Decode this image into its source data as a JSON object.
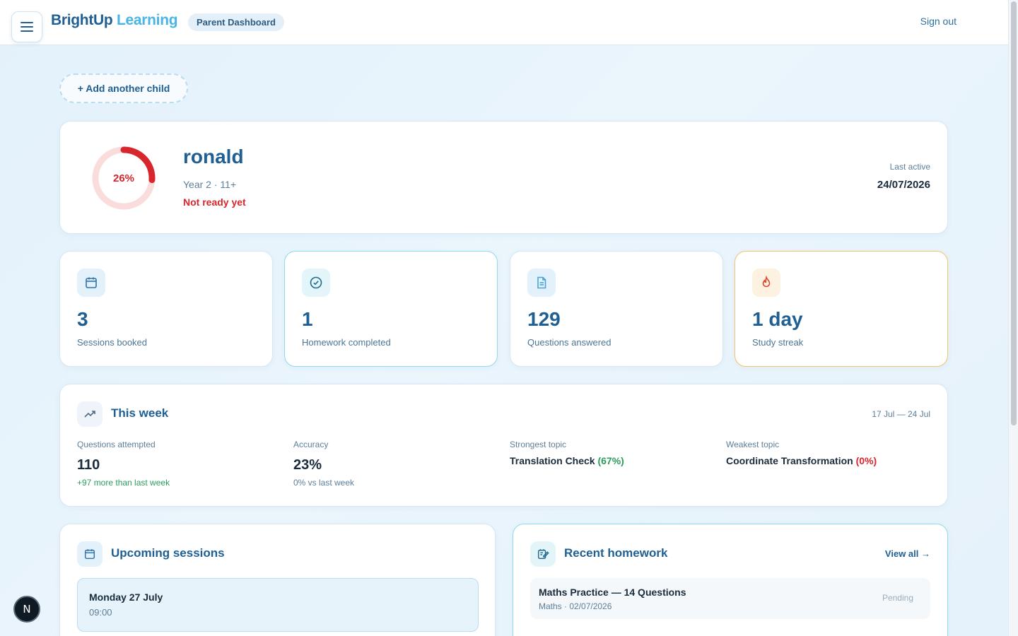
{
  "header": {
    "brand_part1": "BrightUp",
    "brand_part2": "Learning",
    "role_badge": "Parent Dashboard",
    "signout": "Sign out",
    "menu_icon": "hamburger-menu-icon"
  },
  "actions": {
    "add_child": "+ Add another child"
  },
  "profile": {
    "readiness_percent": "26%",
    "readiness_value": 0.26,
    "name": "ronald",
    "meta": "Year 2 · 11+",
    "status": "Not ready yet",
    "last_active_label": "Last active",
    "last_active_date": "24/07/2026"
  },
  "stats": [
    {
      "icon": "calendar-icon",
      "value": "3",
      "label": "Sessions booked"
    },
    {
      "icon": "check-circle-icon",
      "value": "1",
      "label": "Homework completed"
    },
    {
      "icon": "document-icon",
      "value": "129",
      "label": "Questions answered"
    },
    {
      "icon": "flame-icon",
      "value": "1 day",
      "label": "Study streak"
    }
  ],
  "week": {
    "icon": "trending-up-icon",
    "title": "This week",
    "range": "17 Jul — 24 Jul",
    "attempted_label": "Questions attempted",
    "attempted_value": "110",
    "attempted_sub": "+97 more than last week",
    "accuracy_label": "Accuracy",
    "accuracy_value": "23%",
    "accuracy_sub": "0% vs last week",
    "strongest_label": "Strongest topic",
    "strongest_topic": "Translation Check",
    "strongest_pct": "(67%)",
    "weakest_label": "Weakest topic",
    "weakest_topic": "Coordinate Transformation",
    "weakest_pct": "(0%)"
  },
  "upcoming": {
    "icon": "calendar-icon",
    "title": "Upcoming sessions",
    "items": [
      {
        "date": "Monday 27 July",
        "time": "09:00"
      }
    ]
  },
  "homework": {
    "icon": "edit-note-icon",
    "title": "Recent homework",
    "view_all": "View all →",
    "items": [
      {
        "title": "Maths Practice — 14 Questions",
        "meta": "Maths · 02/07/2026",
        "status": "Pending"
      }
    ]
  },
  "devtools_badge": "N",
  "colors": {
    "primary": "#1f5f93",
    "accent": "#49b4e6",
    "danger": "#d7262c",
    "success": "#2b9d5c",
    "streak_border": "#f2c46b",
    "homework_border": "#8fdbe8"
  }
}
